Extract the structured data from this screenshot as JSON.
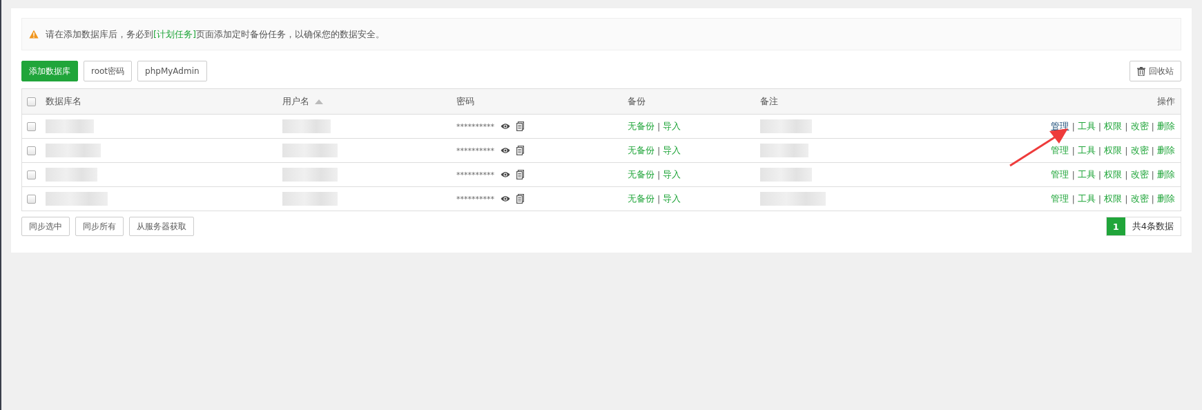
{
  "notice": {
    "link": "[计划任务]",
    "before": "请在添加数据库后，务必到",
    "after": "页面添加定时备份任务，以确保您的数据安全。"
  },
  "toolbar": {
    "buttons": [
      {
        "label": "添加数据库",
        "kind": "primary"
      },
      {
        "label": "root密码",
        "kind": "default"
      },
      {
        "label": "phpMyAdmin",
        "kind": "default"
      }
    ],
    "recycle": {
      "label": "回收站"
    }
  },
  "table": {
    "select_all": {
      "checked": false
    },
    "columns": [
      {
        "label": "数据库名",
        "sorted": false
      },
      {
        "label": "用户名",
        "sorted": true
      },
      {
        "label": "密码",
        "sorted": false
      },
      {
        "label": "备份",
        "sorted": false
      },
      {
        "label": "备注",
        "sorted": false
      },
      {
        "label": "操作",
        "sorted": false
      }
    ],
    "rows": [
      {
        "checked": false,
        "password": "**********",
        "backup": [
          {
            "kind": "link",
            "label": "无备份"
          },
          {
            "kind": "separator",
            "label": "|"
          },
          {
            "kind": "link",
            "label": "导入"
          }
        ],
        "actions": [
          {
            "kind": "link",
            "label": "管理",
            "hovered": true
          },
          {
            "kind": "separator",
            "label": "|"
          },
          {
            "kind": "link",
            "label": "工具",
            "hovered": false
          },
          {
            "kind": "separator",
            "label": "|"
          },
          {
            "kind": "link",
            "label": "权限",
            "hovered": false
          },
          {
            "kind": "separator",
            "label": "|"
          },
          {
            "kind": "link",
            "label": "改密",
            "hovered": false
          },
          {
            "kind": "separator",
            "label": "|"
          },
          {
            "kind": "link",
            "label": "删除",
            "hovered": false
          }
        ]
      },
      {
        "checked": false,
        "password": "**********",
        "backup": [
          {
            "kind": "link",
            "label": "无备份"
          },
          {
            "kind": "separator",
            "label": "|"
          },
          {
            "kind": "link",
            "label": "导入"
          }
        ],
        "actions": [
          {
            "kind": "link",
            "label": "管理",
            "hovered": false
          },
          {
            "kind": "separator",
            "label": "|"
          },
          {
            "kind": "link",
            "label": "工具",
            "hovered": false
          },
          {
            "kind": "separator",
            "label": "|"
          },
          {
            "kind": "link",
            "label": "权限",
            "hovered": false
          },
          {
            "kind": "separator",
            "label": "|"
          },
          {
            "kind": "link",
            "label": "改密",
            "hovered": false
          },
          {
            "kind": "separator",
            "label": "|"
          },
          {
            "kind": "link",
            "label": "删除",
            "hovered": false
          }
        ]
      },
      {
        "checked": false,
        "password": "**********",
        "backup": [
          {
            "kind": "link",
            "label": "无备份"
          },
          {
            "kind": "separator",
            "label": "|"
          },
          {
            "kind": "link",
            "label": "导入"
          }
        ],
        "actions": [
          {
            "kind": "link",
            "label": "管理",
            "hovered": false
          },
          {
            "kind": "separator",
            "label": "|"
          },
          {
            "kind": "link",
            "label": "工具",
            "hovered": false
          },
          {
            "kind": "separator",
            "label": "|"
          },
          {
            "kind": "link",
            "label": "权限",
            "hovered": false
          },
          {
            "kind": "separator",
            "label": "|"
          },
          {
            "kind": "link",
            "label": "改密",
            "hovered": false
          },
          {
            "kind": "separator",
            "label": "|"
          },
          {
            "kind": "link",
            "label": "删除",
            "hovered": false
          }
        ]
      },
      {
        "checked": false,
        "password": "**********",
        "backup": [
          {
            "kind": "link",
            "label": "无备份"
          },
          {
            "kind": "separator",
            "label": "|"
          },
          {
            "kind": "link",
            "label": "导入"
          }
        ],
        "actions": [
          {
            "kind": "link",
            "label": "管理",
            "hovered": false
          },
          {
            "kind": "separator",
            "label": "|"
          },
          {
            "kind": "link",
            "label": "工具",
            "hovered": false
          },
          {
            "kind": "separator",
            "label": "|"
          },
          {
            "kind": "link",
            "label": "权限",
            "hovered": false
          },
          {
            "kind": "separator",
            "label": "|"
          },
          {
            "kind": "link",
            "label": "改密",
            "hovered": false
          },
          {
            "kind": "separator",
            "label": "|"
          },
          {
            "kind": "link",
            "label": "删除",
            "hovered": false
          }
        ]
      }
    ]
  },
  "footer": {
    "buttons": [
      "同步选中",
      "同步所有",
      "从服务器获取"
    ],
    "pagination": {
      "pages": [
        {
          "label": "1",
          "selected": true
        }
      ],
      "total": "共4条数据"
    }
  },
  "annotation": {
    "kind": "arrow"
  }
}
